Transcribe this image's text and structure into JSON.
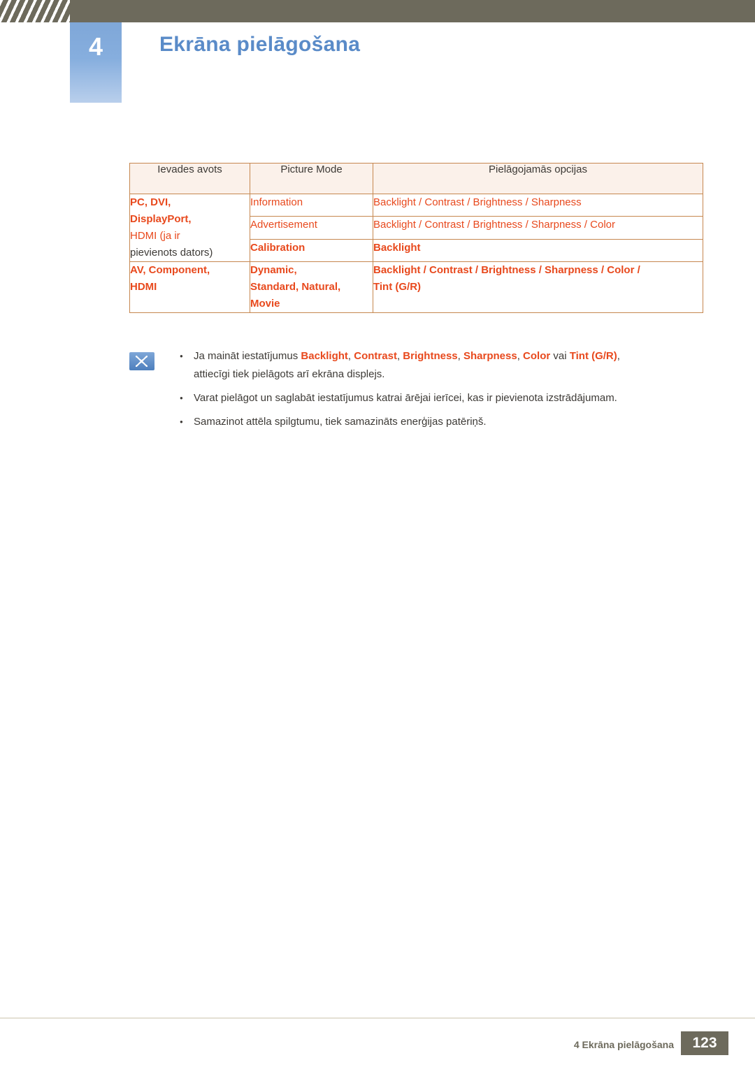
{
  "header": {
    "chapter_number": "4",
    "chapter_title": "Ekrāna pielāgošana"
  },
  "table": {
    "headers": [
      "Ievades avots",
      "Picture Mode",
      "Pielāgojamās opcijas"
    ],
    "rows": [
      {
        "source_lines": [
          "PC, DVI,",
          "DisplayPort,",
          "HDMI (ja ir",
          "pievienots dators)"
        ],
        "modes": [
          "Information",
          "Advertisement",
          "Calibration"
        ],
        "options": [
          "Backlight / Contrast / Brightness / Sharpness",
          "Backlight / Contrast / Brightness / Sharpness / Color",
          "Backlight"
        ]
      },
      {
        "source_lines": [
          "AV, Component,",
          "HDMI"
        ],
        "modes": [
          "Dynamic,",
          "Standard, Natural,",
          "Movie"
        ],
        "options": [
          "Backlight / Contrast / Brightness / Sharpness / Color /",
          "Tint (G/R)"
        ]
      }
    ]
  },
  "notes": {
    "icon": "note-icon",
    "items": [
      {
        "prefix": "Ja maināt iestatījumus ",
        "highlights": [
          "Backlight",
          "Contrast",
          "Brightness",
          "Sharpness",
          "Color"
        ],
        "mid": " vai ",
        "last_highlight": "Tint (G/R)",
        "suffix": ",",
        "second_line": "attiecīgi tiek pielāgots arī ekrāna displejs."
      },
      {
        "text": "Varat pielāgot un saglabāt iestatījumus katrai ārējai ierīcei, kas ir pievienota izstrādājumam."
      },
      {
        "text": "Samazinot attēla spilgtumu, tiek samazināts enerģijas patēriņš."
      }
    ]
  },
  "footer": {
    "text": "4 Ekrāna pielāgošana",
    "page": "123"
  }
}
